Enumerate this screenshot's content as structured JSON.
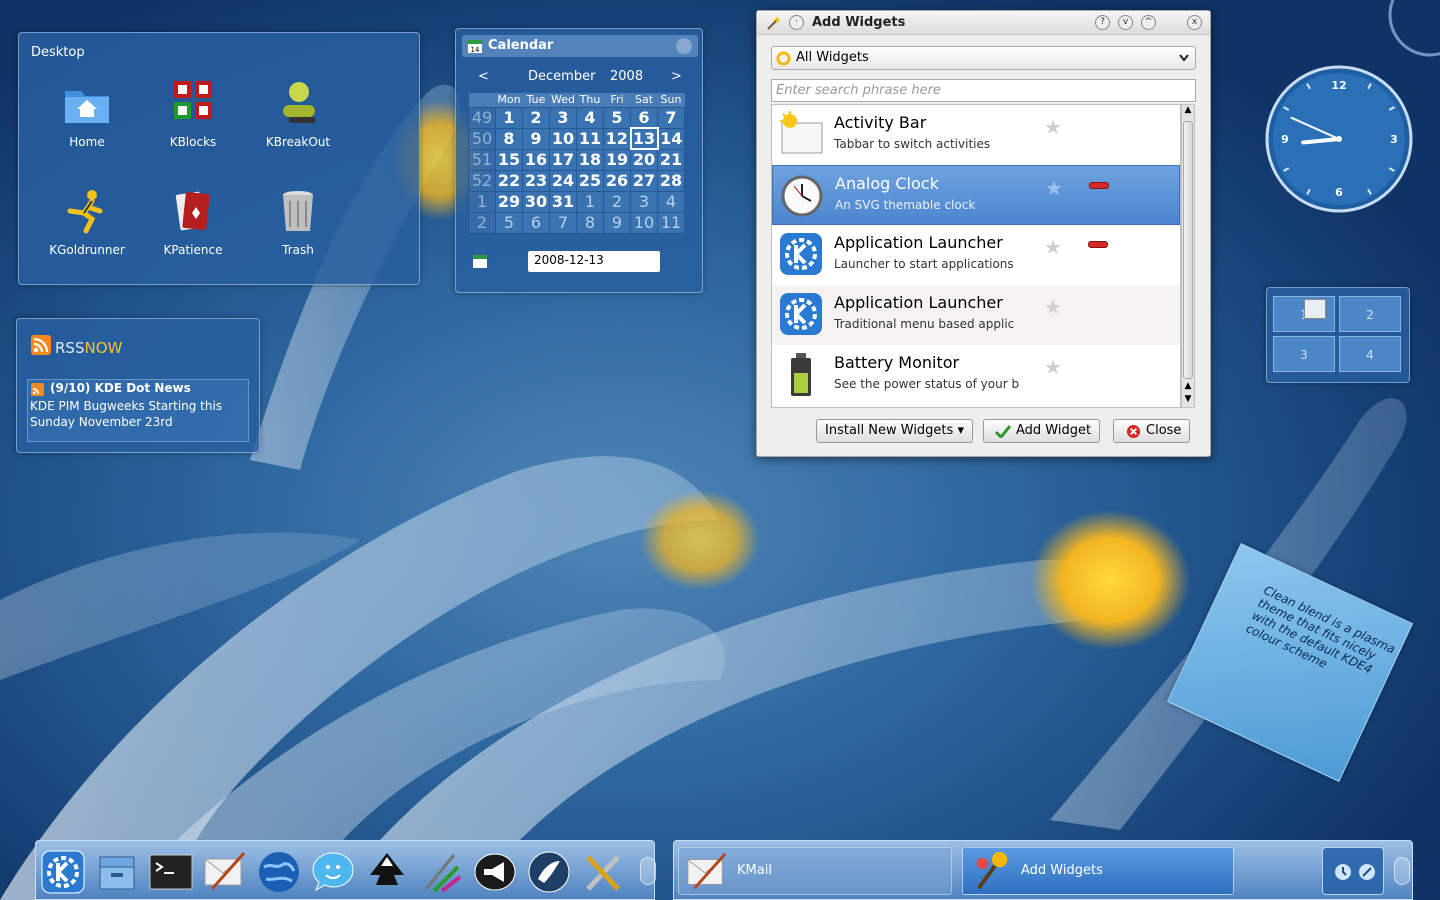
{
  "folderview": {
    "title": "Desktop",
    "icons": [
      {
        "label": "Home",
        "icon": "home-folder-icon"
      },
      {
        "label": "KBlocks",
        "icon": "kblocks-icon"
      },
      {
        "label": "KBreakOut",
        "icon": "kbreakout-icon"
      },
      {
        "label": "KGoldrunner",
        "icon": "kgoldrunner-icon"
      },
      {
        "label": "KPatience",
        "icon": "kpatience-icon"
      },
      {
        "label": "Trash",
        "icon": "trash-icon"
      }
    ]
  },
  "calendar": {
    "title": "Calendar",
    "icon_day": "14",
    "month": "December",
    "year": "2008",
    "prev": "<",
    "next": ">",
    "weekdays": [
      "Mon",
      "Tue",
      "Wed",
      "Thu",
      "Fri",
      "Sat",
      "Sun"
    ],
    "weeks": [
      {
        "wk": "49",
        "days": [
          "1",
          "2",
          "3",
          "4",
          "5",
          "6",
          "7"
        ]
      },
      {
        "wk": "50",
        "days": [
          "8",
          "9",
          "10",
          "11",
          "12",
          "13",
          "14"
        ]
      },
      {
        "wk": "51",
        "days": [
          "15",
          "16",
          "17",
          "18",
          "19",
          "20",
          "21"
        ]
      },
      {
        "wk": "52",
        "days": [
          "22",
          "23",
          "24",
          "25",
          "26",
          "27",
          "28"
        ]
      },
      {
        "wk": "1",
        "days": [
          "29",
          "30",
          "31",
          "1",
          "2",
          "3",
          "4"
        ]
      },
      {
        "wk": "2",
        "days": [
          "5",
          "6",
          "7",
          "8",
          "9",
          "10",
          "11"
        ]
      }
    ],
    "today": "13",
    "date_field": "2008-12-13"
  },
  "rss": {
    "logo_text_a": "RSS",
    "logo_text_b": "NOW",
    "feed_title": "(9/10) KDE Dot News",
    "item_line1": "KDE PIM Bugweeks Starting this",
    "item_line2": "Sunday November 23rd"
  },
  "dialog": {
    "title": "Add Widgets",
    "filter_value": "All Widgets",
    "search_placeholder": "Enter search phrase here",
    "widgets": [
      {
        "name": "Activity Bar",
        "desc": "Tabbar to switch activities",
        "icon": "activity-bar-icon",
        "selected": false,
        "in_use": false
      },
      {
        "name": "Analog Clock",
        "desc": "An SVG themable clock",
        "icon": "analog-clock-icon",
        "selected": true,
        "in_use": true
      },
      {
        "name": "Application Launcher",
        "desc": "Launcher to start applications",
        "icon": "kde-launcher-icon",
        "selected": false,
        "in_use": true
      },
      {
        "name": "Application Launcher",
        "desc": "Traditional menu based applic",
        "icon": "kde-launcher-icon",
        "selected": false,
        "in_use": false
      },
      {
        "name": "Battery Monitor",
        "desc": "See the power status of your b",
        "icon": "battery-icon",
        "selected": false,
        "in_use": false
      }
    ],
    "install_button": "Install New Widgets",
    "add_button": "Add Widget",
    "close_button": "Close"
  },
  "clock": {
    "n12": "12",
    "n3": "3",
    "n6": "6",
    "n9": "9",
    "hour": 8,
    "minute": 49
  },
  "pager": {
    "desktops": [
      "1",
      "2",
      "3",
      "4"
    ],
    "current": "1"
  },
  "note": {
    "text": "Clean blend is a plasma theme that fits nicely with the default KDE4 colour scheme"
  },
  "taskbar": {
    "launchers": [
      "kde-menu-icon",
      "file-manager-icon",
      "terminal-icon",
      "kmail-icon",
      "browser-globe-icon",
      "chat-icon",
      "inkscape-icon",
      "paint-brushes-icon",
      "announcement-icon",
      "system-settings-icon",
      "tools-icon"
    ],
    "tasks": [
      {
        "label": "KMail",
        "icon": "kmail-icon",
        "active": false
      },
      {
        "label": "Add Widgets",
        "icon": "add-widgets-icon",
        "active": true
      }
    ]
  },
  "colors": {
    "accent": "#4c86cf",
    "panel": "#2f68a0",
    "close_red": "#d42a2a"
  }
}
